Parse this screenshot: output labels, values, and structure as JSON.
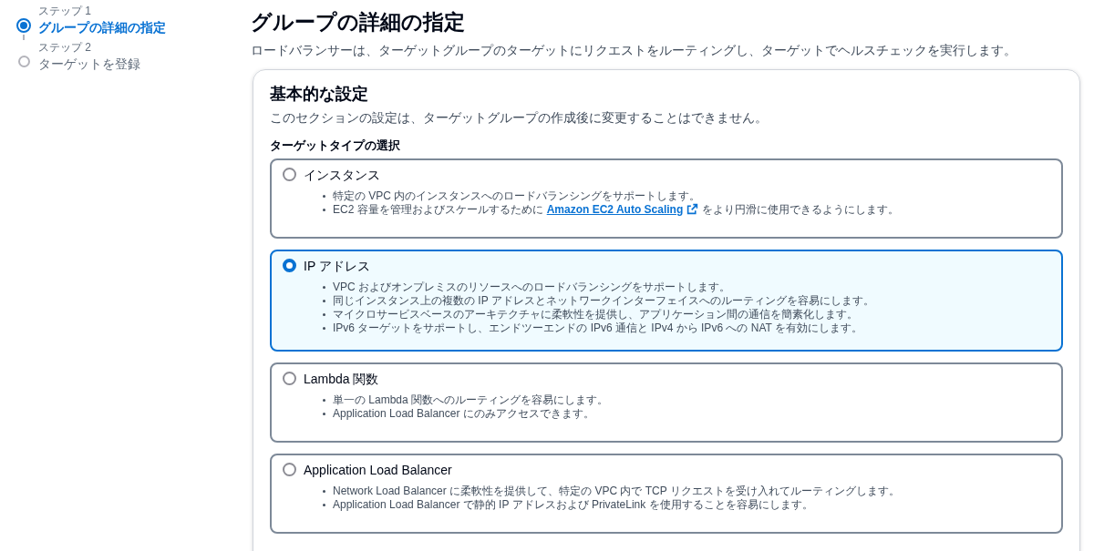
{
  "steps": [
    {
      "label": "ステップ 1",
      "title": "グループの詳細の指定",
      "selected": true
    },
    {
      "label": "ステップ 2",
      "title": "ターゲットを登録",
      "selected": false
    }
  ],
  "page": {
    "title": "グループの詳細の指定",
    "description": "ロードバランサーは、ターゲットグループのターゲットにリクエストをルーティングし、ターゲットでヘルスチェックを実行します。"
  },
  "section": {
    "title": "基本的な設定",
    "description": "このセクションの設定は、ターゲットグループの作成後に変更することはできません。",
    "field_label": "ターゲットタイプの選択",
    "options": [
      {
        "label": "インスタンス",
        "selected": false,
        "bullets": [
          {
            "text": "特定の VPC 内のインスタンスへのロードバランシングをサポートします。"
          },
          {
            "text": "EC2 容量を管理およびスケールするために",
            "link": "Amazon EC2 Auto Scaling",
            "after": "をより円滑に使用できるようにします。"
          }
        ]
      },
      {
        "label": "IP アドレス",
        "selected": true,
        "bullets": [
          {
            "text": "VPC およびオンプレミスのリソースへのロードバランシングをサポートします。"
          },
          {
            "text": "同じインスタンス上の複数の IP アドレスとネットワークインターフェイスへのルーティングを容易にします。"
          },
          {
            "text": "マイクロサービスベースのアーキテクチャに柔軟性を提供し、アプリケーション間の通信を簡素化します。"
          },
          {
            "text": "IPv6 ターゲットをサポートし、エンドツーエンドの IPv6 通信と IPv4 から IPv6 への NAT を有効にします。"
          }
        ]
      },
      {
        "label": "Lambda 関数",
        "selected": false,
        "bullets": [
          {
            "text": "単一の Lambda 関数へのルーティングを容易にします。"
          },
          {
            "text": "Application Load Balancer にのみアクセスできます。"
          }
        ]
      },
      {
        "label": "Application Load Balancer",
        "selected": false,
        "bullets": [
          {
            "text": "Network Load Balancer に柔軟性を提供して、特定の VPC 内で TCP リクエストを受け入れてルーティングします。"
          },
          {
            "text": "Application Load Balancer で静的 IP アドレスおよび PrivateLink を使用することを容易にします。"
          }
        ]
      }
    ]
  }
}
